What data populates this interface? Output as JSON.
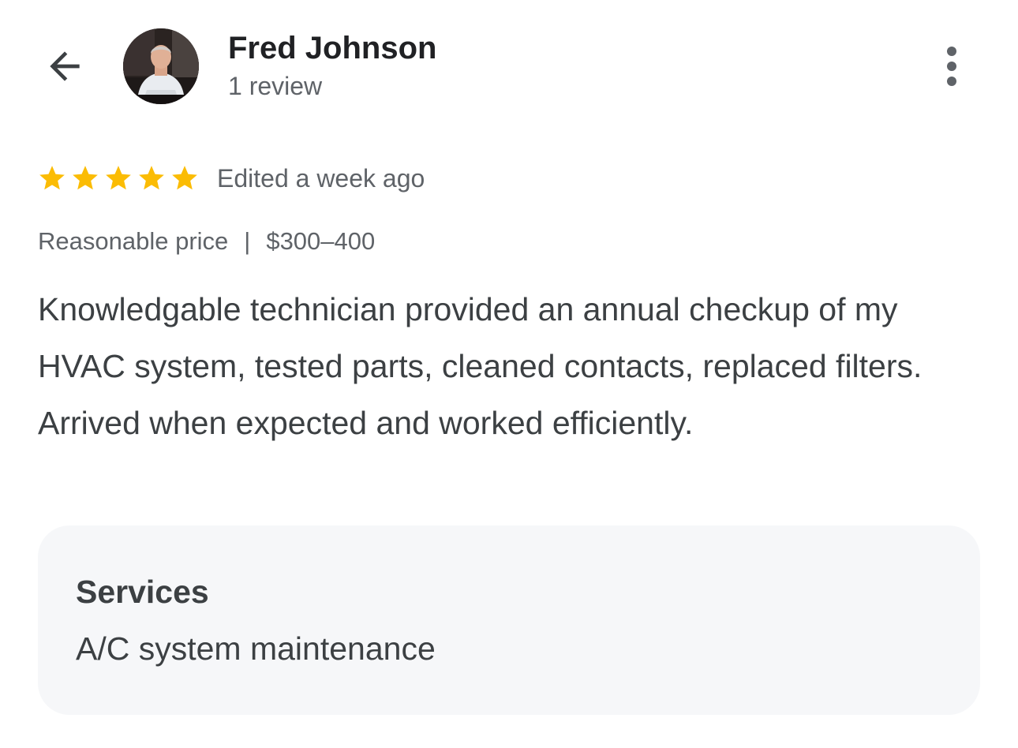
{
  "header": {
    "author_name": "Fred Johnson",
    "review_count": "1 review",
    "back_icon": "arrow-left-icon",
    "more_icon": "more-vert-icon"
  },
  "review": {
    "rating": 5,
    "max_rating": 5,
    "star_color": "#fbbc04",
    "edited": "Edited a week ago",
    "price_label": "Reasonable price",
    "price_separator": "|",
    "price_range": "$300–400",
    "text": "Knowledgable technician provided an annual checkup of my HVAC system, tested parts, cleaned contacts, replaced filters. Arrived when expected and worked efficiently."
  },
  "services": {
    "title": "Services",
    "value": "A/C system maintenance"
  }
}
